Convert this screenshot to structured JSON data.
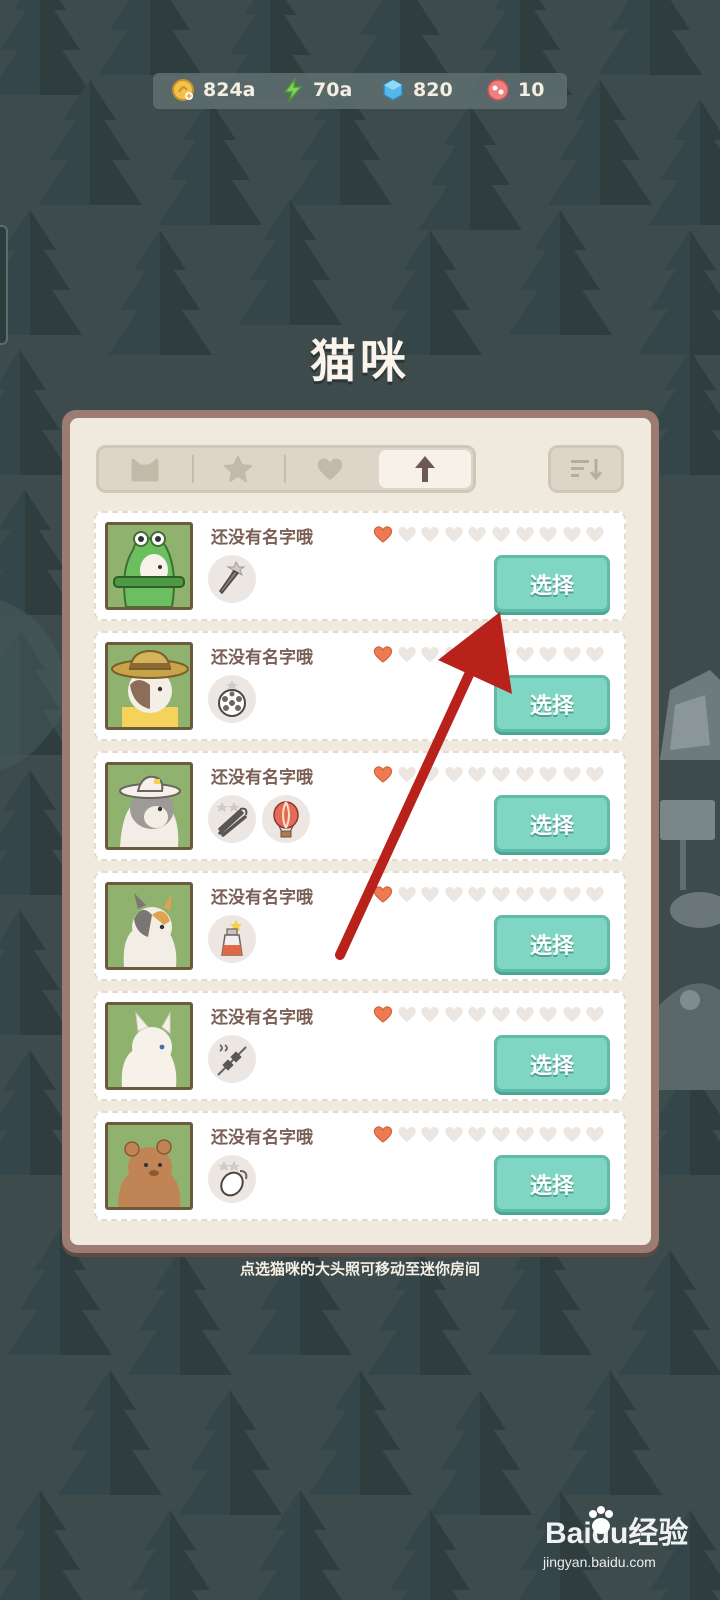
{
  "currency": [
    {
      "icon": "coin-icon",
      "value": "824a",
      "color": "#f2c04b"
    },
    {
      "icon": "energy-bolt-icon",
      "value": "70a",
      "color": "#7fd35a"
    },
    {
      "icon": "gem-icon",
      "value": "820",
      "color": "#54b9e8"
    },
    {
      "icon": "candy-icon",
      "value": "10",
      "color": "#f07f7f"
    }
  ],
  "title": "猫咪",
  "tabs": [
    {
      "icon": "cat-head-icon",
      "active": false
    },
    {
      "icon": "star-icon",
      "active": false
    },
    {
      "icon": "heart-icon",
      "active": false
    },
    {
      "icon": "arrow-up-icon",
      "active": true
    }
  ],
  "sort_icon": "sort-icon",
  "cats": [
    {
      "name": "还没有名字哦",
      "hearts_filled": 1,
      "hearts_total": 10,
      "items": [
        "carrot-icon"
      ],
      "select_label": "选择",
      "avatar": "frog-hood-cat"
    },
    {
      "name": "还没有名字哦",
      "hearts_filled": 1,
      "hearts_total": 10,
      "items": [
        "lotus-root-icon"
      ],
      "select_label": "选择",
      "avatar": "straw-hat-cat"
    },
    {
      "name": "还没有名字哦",
      "hearts_filled": 1,
      "hearts_total": 10,
      "items": [
        "celery-icon",
        "hot-air-balloon-icon"
      ],
      "select_label": "选择",
      "avatar": "hat-gray-cat"
    },
    {
      "name": "还没有名字哦",
      "hearts_filled": 1,
      "hearts_total": 10,
      "items": [
        "star-bottle-icon"
      ],
      "select_label": "选择",
      "avatar": "calico-cat"
    },
    {
      "name": "还没有名字哦",
      "hearts_filled": 1,
      "hearts_total": 10,
      "items": [
        "skewer-icon"
      ],
      "select_label": "选择",
      "avatar": "white-cat"
    },
    {
      "name": "还没有名字哦",
      "hearts_filled": 1,
      "hearts_total": 10,
      "items": [
        "radish-icon"
      ],
      "select_label": "选择",
      "avatar": "bear-cat"
    }
  ],
  "hint": "点选猫咪的大头照可移动至迷你房间",
  "watermark": {
    "logo": "Baidu经验",
    "url_text": "jingyan.baidu.com"
  },
  "colors": {
    "heart_filled": "#ef7a52",
    "heart_empty": "#ebe6e1",
    "select_button": "#7fd6c3",
    "arrow": "#b8221b"
  }
}
